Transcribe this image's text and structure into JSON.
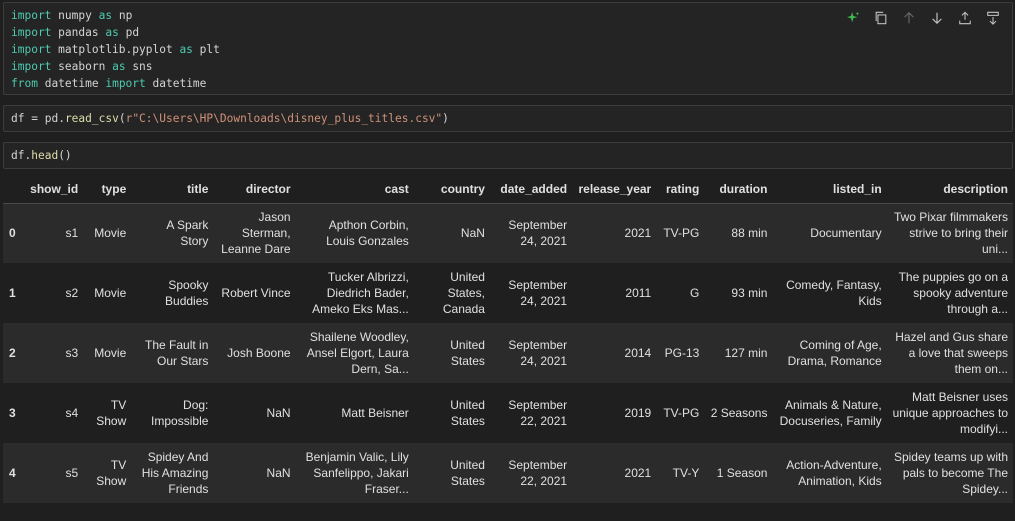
{
  "cells": {
    "imports": [
      {
        "kw": "import",
        "name": "numpy",
        "as": "as",
        "alias": "np"
      },
      {
        "kw": "import",
        "name": "pandas",
        "as": "as",
        "alias": "pd"
      },
      {
        "kw": "import",
        "name": "matplotlib.pyplot",
        "as": "as",
        "alias": "plt"
      },
      {
        "kw": "import",
        "name": "seaborn",
        "as": "as",
        "alias": "sns"
      },
      {
        "kw": "from",
        "name": "datetime",
        "as": "import",
        "alias": "datetime"
      }
    ],
    "read_csv": {
      "var": "df",
      "eq": " = ",
      "mod": "pd",
      "dot": ".",
      "fn": "read_csv",
      "open": "(",
      "arg": "r\"C:\\Users\\HP\\Downloads\\disney_plus_titles.csv\"",
      "close": ")"
    },
    "head": {
      "var": "df",
      "dot": ".",
      "fn": "head",
      "parens": "()"
    }
  },
  "toolbar": [
    "sparkle-icon",
    "copy-icon",
    "arrow-up-icon",
    "arrow-down-icon",
    "insert-above-icon",
    "insert-below-icon"
  ],
  "table": {
    "columns": [
      "",
      "show_id",
      "type",
      "title",
      "director",
      "cast",
      "country",
      "date_added",
      "release_year",
      "rating",
      "duration",
      "listed_in",
      "description"
    ],
    "rows": [
      [
        "0",
        "s1",
        "Movie",
        "A Spark Story",
        "Jason Sterman, Leanne Dare",
        "Apthon Corbin, Louis Gonzales",
        "NaN",
        "September 24, 2021",
        "2021",
        "TV-PG",
        "88 min",
        "Documentary",
        "Two Pixar filmmakers strive to bring their uni..."
      ],
      [
        "1",
        "s2",
        "Movie",
        "Spooky Buddies",
        "Robert Vince",
        "Tucker Albrizzi, Diedrich Bader, Ameko Eks Mas...",
        "United States, Canada",
        "September 24, 2021",
        "2011",
        "G",
        "93 min",
        "Comedy, Fantasy, Kids",
        "The puppies go on a spooky adventure through a..."
      ],
      [
        "2",
        "s3",
        "Movie",
        "The Fault in Our Stars",
        "Josh Boone",
        "Shailene Woodley, Ansel Elgort, Laura Dern, Sa...",
        "United States",
        "September 24, 2021",
        "2014",
        "PG-13",
        "127 min",
        "Coming of Age, Drama, Romance",
        "Hazel and Gus share a love that sweeps them on..."
      ],
      [
        "3",
        "s4",
        "TV Show",
        "Dog: Impossible",
        "NaN",
        "Matt Beisner",
        "United States",
        "September 22, 2021",
        "2019",
        "TV-PG",
        "2 Seasons",
        "Animals & Nature, Docuseries, Family",
        "Matt Beisner uses unique approaches to modifyi..."
      ],
      [
        "4",
        "s5",
        "TV Show",
        "Spidey And His Amazing Friends",
        "NaN",
        "Benjamin Valic, Lily Sanfelippo, Jakari Fraser...",
        "United States",
        "September 22, 2021",
        "2021",
        "TV-Y",
        "1 Season",
        "Action-Adventure, Animation, Kids",
        "Spidey teams up with pals to become The Spidey..."
      ]
    ]
  },
  "colors": {
    "keyword": "#4ec9b0",
    "function": "#dcdcaa",
    "string": "#ce9178",
    "variable": "#9cdcfe",
    "accent": "#3fb950"
  }
}
